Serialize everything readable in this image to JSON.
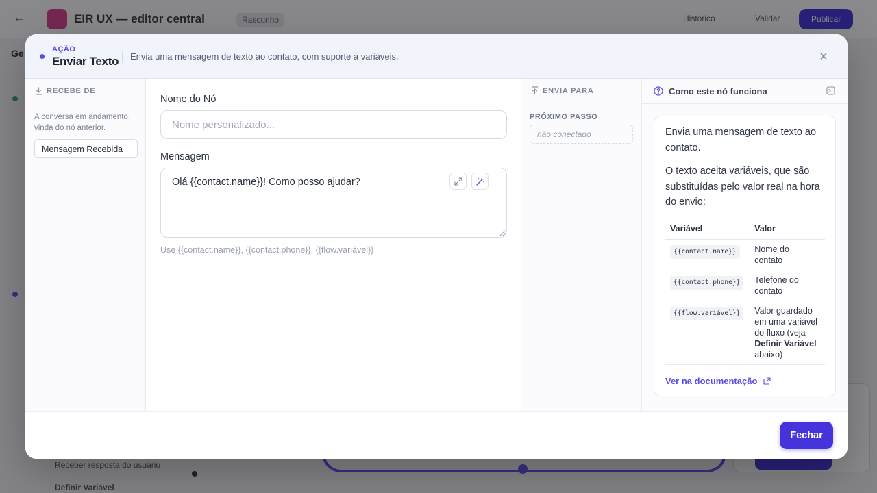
{
  "background": {
    "app_title": "EIR UX — editor central",
    "chip": "Rascunho",
    "header_buttons": [
      "Histórico",
      "Validar",
      "Publicar"
    ],
    "side_label": "Ge",
    "list_item_1": "Receber resposta do usuário",
    "list_item_2": "Definir Variável"
  },
  "modal": {
    "kicker": "AÇÃO",
    "title": "Enviar Texto",
    "description": "Envia uma mensagem de texto ao contato, com suporte a variáveis.",
    "close_icon": "close-icon"
  },
  "left_panel": {
    "heading": "RECEBE DE",
    "description": "A conversa em andamento, vinda do nó anterior.",
    "source_pill": "Mensagem Recebida"
  },
  "form": {
    "name_label": "Nome do Nó",
    "name_value": "",
    "name_placeholder": "Nome personalizado...",
    "message_label": "Mensagem",
    "message_value": "Olá {{contact.name}}! Como posso ajudar?",
    "hint": "Use {{contact.name}}, {{contact.phone}}, {{flow.variável}}"
  },
  "right_panel": {
    "heading": "ENVIA PARA",
    "next_label": "PRÓXIMO PASSO",
    "next_value": "não conectado"
  },
  "help": {
    "title": "Como este nó funciona",
    "p1": "Envia uma mensagem de texto ao contato.",
    "p2": "O texto aceita variáveis, que são substituídas pelo valor real na hora do envio:",
    "table_headers": [
      "Variável",
      "Valor"
    ],
    "rows": [
      {
        "var": "{{contact.name}}",
        "value": "Nome do contato"
      },
      {
        "var": "{{contact.phone}}",
        "value": "Telefone do contato"
      },
      {
        "var": "{{flow.variável}}",
        "value_pre": "Valor guardado em uma variável do fluxo (veja ",
        "value_bold": "Definir Variável",
        "value_post": " abaixo)"
      }
    ],
    "doc_link": "Ver na documentação"
  },
  "footer": {
    "close_button": "Fechar"
  },
  "colors": {
    "accent": "#5b4ce6",
    "primary_button": "#4534dc",
    "header_bg": "#f2f4fc"
  }
}
